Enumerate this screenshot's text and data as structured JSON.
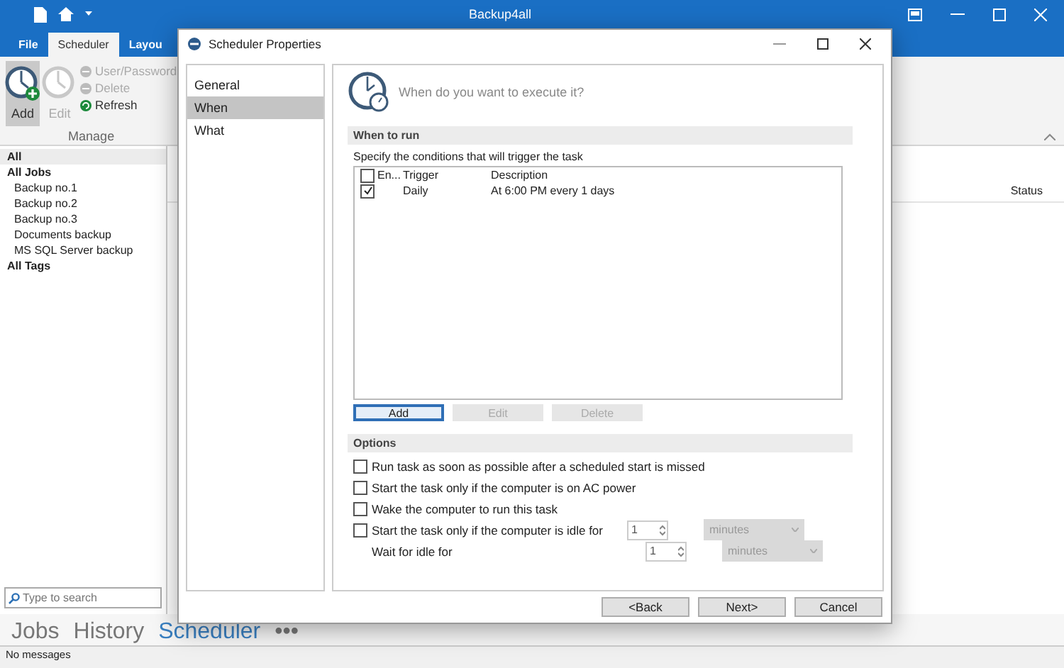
{
  "app": {
    "title": "Backup4all",
    "ribbon_tabs": [
      {
        "label": "File",
        "selected": false
      },
      {
        "label": "Scheduler",
        "selected": true
      },
      {
        "label": "Layou",
        "selected": false
      }
    ],
    "ribbon": {
      "large_buttons": [
        {
          "label": "Add",
          "selected": true,
          "disabled": false
        },
        {
          "label": "Edit",
          "selected": false,
          "disabled": true
        }
      ],
      "small_buttons": [
        {
          "label": "User/Password",
          "disabled": true
        },
        {
          "label": "Delete",
          "disabled": true
        },
        {
          "label": "Refresh",
          "disabled": false
        }
      ],
      "group_label": "Manage"
    },
    "tree": [
      {
        "label": "All",
        "selected": true
      },
      {
        "label": "All Jobs",
        "selected": false,
        "children": [
          {
            "label": "Backup no.1",
            "selected": false
          },
          {
            "label": "Backup no.2",
            "selected": false
          },
          {
            "label": "Backup no.3",
            "selected": false
          },
          {
            "label": "Documents backup",
            "selected": false
          },
          {
            "label": "MS SQL Server backup",
            "selected": false
          }
        ]
      },
      {
        "label": "All Tags",
        "selected": false
      }
    ],
    "search": {
      "placeholder": "Type to search"
    },
    "list_columns": [
      "Status"
    ],
    "bottom_tabs": [
      {
        "label": "Jobs",
        "selected": false
      },
      {
        "label": "History",
        "selected": false
      },
      {
        "label": "Scheduler",
        "selected": true
      },
      {
        "label": "•••",
        "selected": false
      }
    ],
    "status_bar": "No messages"
  },
  "dialog": {
    "title": "Scheduler Properties",
    "nav": [
      {
        "label": "General",
        "selected": false
      },
      {
        "label": "When",
        "selected": true
      },
      {
        "label": "What",
        "selected": false
      }
    ],
    "heading": "When do you want to execute it?",
    "when_section": {
      "title": "When to run",
      "instruction": "Specify the conditions that will trigger the task",
      "columns": [
        "En...",
        "Trigger",
        "Description"
      ],
      "header_checked": false,
      "rows": [
        {
          "checked": true,
          "trigger": "Daily",
          "description": "At 6:00 PM every 1 days"
        }
      ],
      "buttons": [
        {
          "label": "Add",
          "disabled": false,
          "focused": true
        },
        {
          "label": "Edit",
          "disabled": true,
          "focused": false
        },
        {
          "label": "Delete",
          "disabled": true,
          "focused": false
        }
      ]
    },
    "options_section": {
      "title": "Options",
      "items": [
        {
          "kind": "checkbox",
          "label": "Run task as soon as possible after a scheduled start is missed",
          "checked": false
        },
        {
          "kind": "checkbox",
          "label": "Start the task only if the computer is on AC power",
          "checked": false
        },
        {
          "kind": "checkbox",
          "label": "Wake the computer to run this task",
          "checked": false
        },
        {
          "kind": "checkbox",
          "label": "Start the task only if the computer is idle for",
          "checked": false,
          "spin_value": "1",
          "unit": "minutes",
          "unit_disabled": true
        },
        {
          "kind": "label",
          "label": "Wait for idle for",
          "spin_value": "1",
          "unit": "minutes",
          "unit_disabled": true
        }
      ]
    },
    "footer_buttons": [
      {
        "label": "<Back"
      },
      {
        "label": "Next>"
      },
      {
        "label": "Cancel"
      }
    ]
  }
}
